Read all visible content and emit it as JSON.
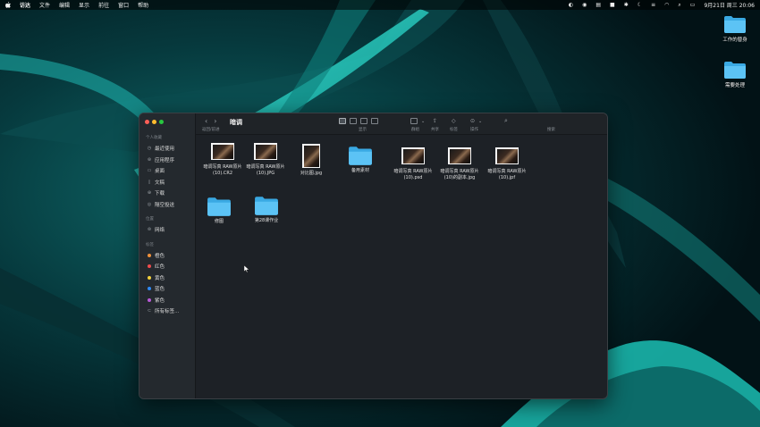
{
  "menubar": {
    "app": "访达",
    "items": [
      "文件",
      "编辑",
      "显示",
      "前往",
      "窗口",
      "帮助"
    ],
    "clock": "9月21日 周三  20:06"
  },
  "desktop": {
    "icons": [
      {
        "label": "工作的替身"
      },
      {
        "label": "需要处理"
      }
    ]
  },
  "finder": {
    "title": "暗调",
    "nav_label": "返回/前进",
    "toolbar": {
      "view_label": "显示",
      "group_label": "群组",
      "share_label": "共享",
      "tag_label": "标签",
      "action_label": "操作",
      "search_label": "搜索"
    },
    "sidebar": {
      "favorites_heading": "个人收藏",
      "favorites": [
        {
          "label": "最近使用",
          "icon": "clock-icon"
        },
        {
          "label": "应用程序",
          "icon": "apps-icon"
        },
        {
          "label": "桌面",
          "icon": "desktop-icon"
        },
        {
          "label": "文稿",
          "icon": "document-icon"
        },
        {
          "label": "下载",
          "icon": "download-icon"
        },
        {
          "label": "隔空投送",
          "icon": "airdrop-icon"
        }
      ],
      "locations_heading": "位置",
      "locations": [
        {
          "label": "网络",
          "icon": "network-icon"
        }
      ],
      "tags_heading": "标签",
      "tags": [
        {
          "label": "橙色",
          "color": "#f0913a"
        },
        {
          "label": "红色",
          "color": "#f04c4c"
        },
        {
          "label": "黄色",
          "color": "#f5d23b"
        },
        {
          "label": "蓝色",
          "color": "#2f8af5"
        },
        {
          "label": "紫色",
          "color": "#b95ad8"
        },
        {
          "label": "所有标签…",
          "color": ""
        }
      ]
    },
    "files": [
      {
        "name": "暗调写真 RAW原片 (10).CR2",
        "kind": "image-landscape"
      },
      {
        "name": "暗调写真 RAW原片 (10).JPG",
        "kind": "image-landscape"
      },
      {
        "name": "对比图.jpg",
        "kind": "image-portrait"
      },
      {
        "name": "备用素材",
        "kind": "folder"
      },
      {
        "name": "暗调写真 RAW原片 (10).psd",
        "kind": "image-landscape"
      },
      {
        "name": "暗调写真 RAW原片 (10)的副本.jpg",
        "kind": "image-landscape"
      },
      {
        "name": "暗调写真 RAW原片 (10).jpf",
        "kind": "image-landscape"
      },
      {
        "name": "修图",
        "kind": "folder"
      },
      {
        "name": "第28课作业",
        "kind": "folder"
      }
    ]
  },
  "colors": {
    "folder": "#3eb0ea",
    "wallpaper_glow": "#1fd6c8"
  }
}
